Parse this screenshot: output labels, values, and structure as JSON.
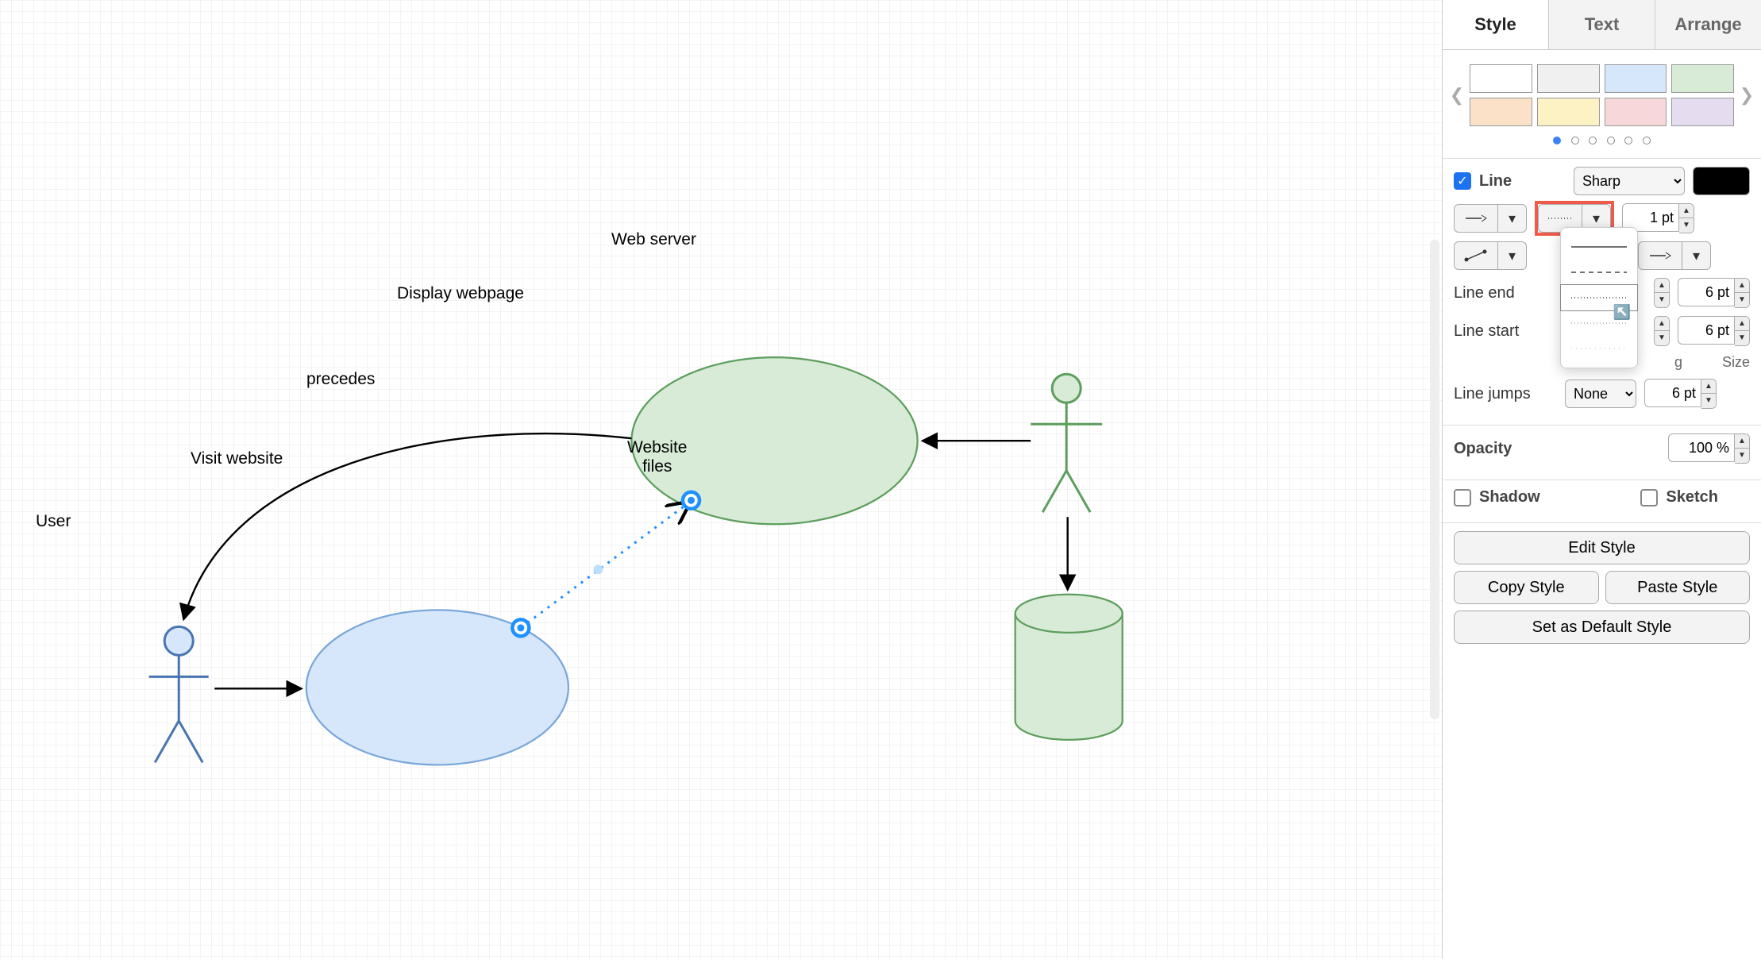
{
  "tabs": {
    "style": "Style",
    "text": "Text",
    "arrange": "Arrange"
  },
  "swatches": {
    "row1": [
      "#ffffff",
      "#f0f0f0",
      "#d7e7fb",
      "#d7ebd7"
    ],
    "row2": [
      "#fbe1c8",
      "#fdf2c4",
      "#f8d7da",
      "#e6dcf0"
    ]
  },
  "line": {
    "label": "Line",
    "checked": true,
    "style_select": "Sharp",
    "color": "#000000",
    "width": "1 pt",
    "line_end_label": "Line end",
    "line_start_label": "Line start",
    "end_size": "6 pt",
    "start_size": "6 pt",
    "size_col": "Size",
    "spacing_col_tail": "g",
    "jumps_label": "Line jumps",
    "jumps_select": "None",
    "jumps_size": "6 pt"
  },
  "opacity": {
    "label": "Opacity",
    "value": "100 %"
  },
  "shadow": {
    "label": "Shadow",
    "checked": false
  },
  "sketch": {
    "label": "Sketch",
    "checked": false
  },
  "buttons": {
    "edit": "Edit Style",
    "copy": "Copy Style",
    "paste": "Paste Style",
    "default": "Set as Default Style"
  },
  "canvas": {
    "user_label": "User",
    "webserver_label": "Web server",
    "visit_label": "Visit website",
    "display_label": "Display webpage",
    "files_label": "Website\nfiles",
    "edge_label": "precedes"
  },
  "chart_data": {
    "type": "diagram",
    "nodes": [
      {
        "id": "user",
        "kind": "actor",
        "label": "User"
      },
      {
        "id": "webserver",
        "kind": "actor",
        "label": "Web server"
      },
      {
        "id": "visit",
        "kind": "usecase",
        "label": "Visit website"
      },
      {
        "id": "display",
        "kind": "usecase",
        "label": "Display webpage"
      },
      {
        "id": "files",
        "kind": "datastore",
        "label": "Website files"
      }
    ],
    "edges": [
      {
        "from": "user",
        "to": "visit",
        "style": "solid-arrow"
      },
      {
        "from": "display",
        "to": "user",
        "style": "solid-arrow-curved"
      },
      {
        "from": "webserver",
        "to": "display",
        "style": "solid-arrow"
      },
      {
        "from": "webserver",
        "to": "files",
        "style": "solid-arrow"
      },
      {
        "from": "visit",
        "to": "display",
        "label": "precedes",
        "style": "dotted-selected"
      }
    ]
  }
}
